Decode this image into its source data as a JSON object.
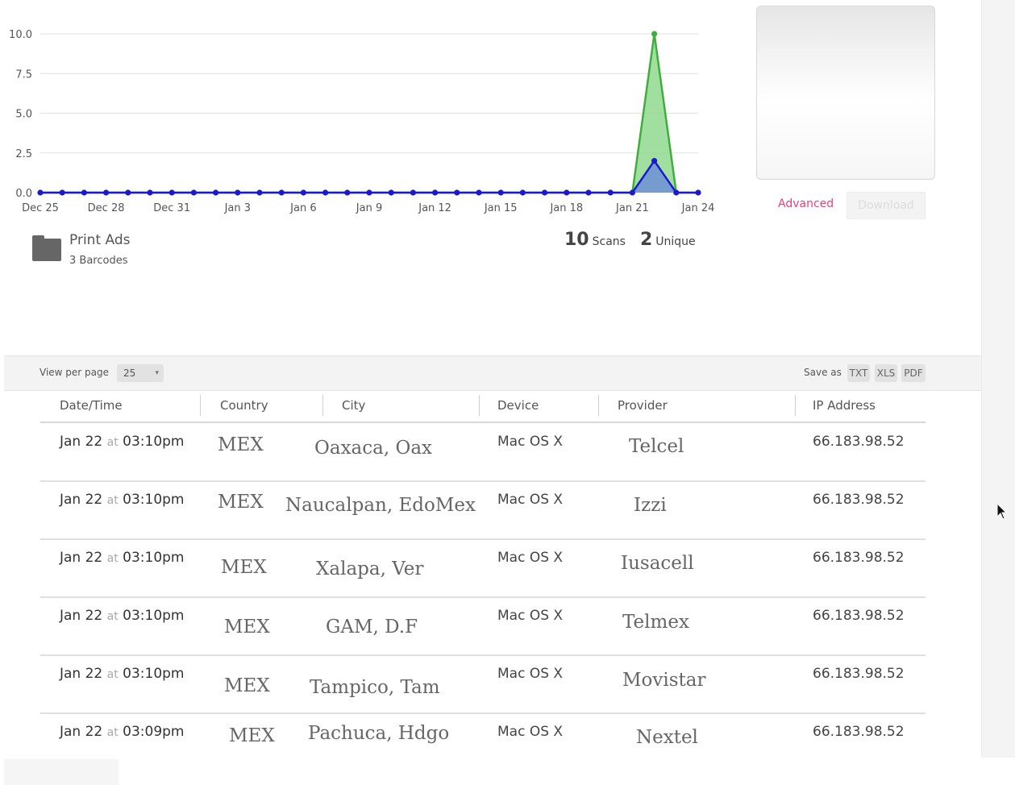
{
  "chart_data": {
    "type": "area",
    "x_ticks": [
      "Dec 25",
      "Dec 28",
      "Dec 31",
      "Jan 3",
      "Jan 6",
      "Jan 9",
      "Jan 12",
      "Jan 15",
      "Jan 18",
      "Jan 21",
      "Jan 24"
    ],
    "y_ticks": [
      "0.0",
      "2.5",
      "5.0",
      "7.5",
      "10.0"
    ],
    "ylim": [
      0,
      10
    ],
    "grid": true,
    "legend": "none",
    "x": [
      "Dec 25",
      "Dec 26",
      "Dec 27",
      "Dec 28",
      "Dec 29",
      "Dec 30",
      "Dec 31",
      "Jan 1",
      "Jan 2",
      "Jan 3",
      "Jan 4",
      "Jan 5",
      "Jan 6",
      "Jan 7",
      "Jan 8",
      "Jan 9",
      "Jan 10",
      "Jan 11",
      "Jan 12",
      "Jan 13",
      "Jan 14",
      "Jan 15",
      "Jan 16",
      "Jan 17",
      "Jan 18",
      "Jan 19",
      "Jan 20",
      "Jan 21",
      "Jan 22",
      "Jan 23",
      "Jan 24"
    ],
    "series": [
      {
        "color": "#3fae3f",
        "fill": "#8fd98f",
        "values": [
          0,
          0,
          0,
          0,
          0,
          0,
          0,
          0,
          0,
          0,
          0,
          0,
          0,
          0,
          0,
          0,
          0,
          0,
          0,
          0,
          0,
          0,
          0,
          0,
          0,
          0,
          0,
          0,
          10,
          0,
          0
        ]
      },
      {
        "color": "#1a1acc",
        "fill": "#6f8fd6",
        "values": [
          0,
          0,
          0,
          0,
          0,
          0,
          0,
          0,
          0,
          0,
          0,
          0,
          0,
          0,
          0,
          0,
          0,
          0,
          0,
          0,
          0,
          0,
          0,
          0,
          0,
          0,
          0,
          0,
          2,
          0,
          0
        ]
      }
    ]
  },
  "campaign": {
    "name": "Print Ads",
    "count": "3 Barcodes"
  },
  "stats": {
    "scans_value": "10",
    "scans_label": "Scans",
    "unique_value": "2",
    "unique_label": "Unique"
  },
  "actions": {
    "advanced": "Advanced",
    "download": "Download"
  },
  "toolbar": {
    "view_per_page_label": "View per page",
    "view_per_page_value": "25",
    "save_as_label": "Save as",
    "formats": [
      "TXT",
      "XLS",
      "PDF"
    ]
  },
  "table": {
    "columns": [
      "Date/Time",
      "Country",
      "City",
      "Device",
      "Provider",
      "IP Address"
    ],
    "at_word": "at",
    "rows": [
      {
        "date": "Jan 22",
        "time": "03:10pm",
        "country": "MEX",
        "city": "Oaxaca, Oax",
        "device": "Mac OS X",
        "provider": "Telcel",
        "ip": "66.183.98.52"
      },
      {
        "date": "Jan 22",
        "time": "03:10pm",
        "country": "MEX",
        "city": "Naucalpan, EdoMex",
        "device": "Mac OS X",
        "provider": "Izzi",
        "ip": "66.183.98.52"
      },
      {
        "date": "Jan 22",
        "time": "03:10pm",
        "country": "MEX",
        "city": "Xalapa, Ver",
        "device": "Mac OS X",
        "provider": "Iusacell",
        "ip": "66.183.98.52"
      },
      {
        "date": "Jan 22",
        "time": "03:10pm",
        "country": "MEX",
        "city": "GAM, D.F",
        "device": "Mac OS X",
        "provider": "Telmex",
        "ip": "66.183.98.52"
      },
      {
        "date": "Jan 22",
        "time": "03:10pm",
        "country": "MEX",
        "city": "Tampico, Tam",
        "device": "Mac OS X",
        "provider": "Movistar",
        "ip": "66.183.98.52"
      },
      {
        "date": "Jan 22",
        "time": "03:09pm",
        "country": "MEX",
        "city": "Pachuca, Hdgo",
        "device": "Mac OS X",
        "provider": "Nextel",
        "ip": "66.183.98.52"
      }
    ]
  },
  "icons": {
    "folder": "folder-icon",
    "cursor": "mouse-cursor-icon",
    "caret": "select-caret-icon"
  }
}
